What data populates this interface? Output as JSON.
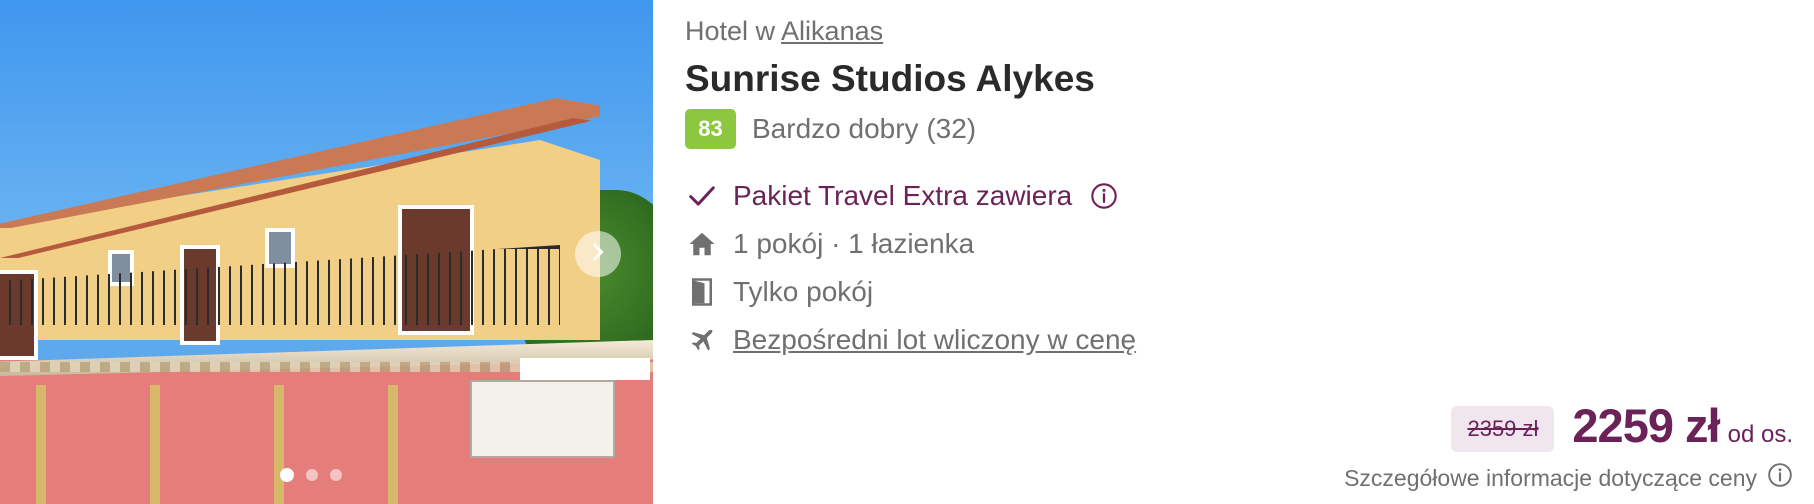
{
  "photo": {
    "alt_icon": "hotel-photo",
    "next_icon": "chevron-right-icon",
    "dots_total": 3,
    "dots_active": 1
  },
  "location": {
    "prefix": "Hotel w ",
    "link": "Alikanas"
  },
  "hotel_name": "Sunrise Studios Alykes",
  "rating": {
    "score": "83",
    "label": "Bardzo dobry (32)",
    "color": "#8dc63f"
  },
  "features": [
    {
      "icon": "checkmark-icon",
      "text": "Pakiet Travel Extra zawiera"
    },
    {
      "icon": "home-icon",
      "text": "1 pokój · 1 łazienka"
    },
    {
      "icon": "door-icon",
      "text": "Tylko pokój"
    },
    {
      "icon": "airplane-icon",
      "text": "Bezpośredni lot wliczony w cenę"
    }
  ],
  "price": {
    "old": "2359 zł",
    "new": "2259 zł",
    "per": "od os.",
    "details": "Szczegółowe informacje dotyczące ceny",
    "accent": "#6b2259"
  }
}
